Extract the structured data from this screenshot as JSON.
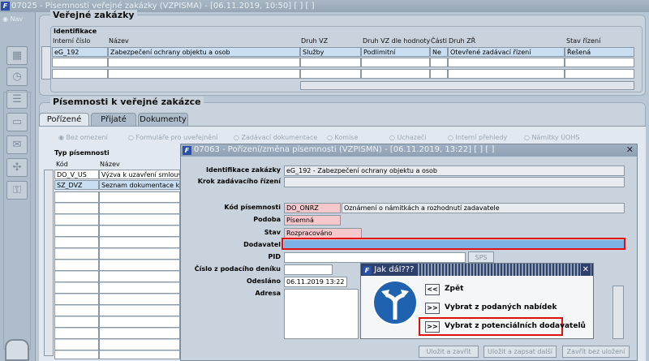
{
  "window": {
    "title": "07025 - Písemnosti veřejné zakázky (VZPISMA) - [06.11.2019, 10:50]   [ ]  [ ]",
    "logo": "F"
  },
  "nav": {
    "label": "Nav"
  },
  "zakazky": {
    "title": "Veřejné zakázky",
    "group_label": "Identifikace",
    "headers": [
      "Interní číslo",
      "Název",
      "Druh VZ",
      "Druh VZ dle hodnoty",
      "Části",
      "Druh ZŘ",
      "Stav řízení"
    ],
    "rows": [
      [
        "eG_192",
        "Zabezpečení ochrany objektu a osob",
        "Služby",
        "Podlimitní",
        "Ne",
        "Otevřené zadávací řízení",
        "Řešená"
      ],
      [
        "",
        "",
        "",
        "",
        "",
        "",
        ""
      ],
      [
        "",
        "",
        "",
        "",
        "",
        "",
        ""
      ]
    ]
  },
  "pisemnosti": {
    "title": "Písemnosti k veřejné zakázce",
    "tabs": [
      "Pořízené",
      "Přijaté",
      "Dokumenty"
    ],
    "radios": [
      "Bez omezení",
      "Formuláře pro uveřejnění",
      "Zadávací dokumentace",
      "Komise",
      "Uchazeči",
      "Interní přehledy",
      "Námitky ÚOHS"
    ],
    "typ_label": "Typ písemnosti",
    "col_kod": "Kód",
    "col_nazev": "Název",
    "rows": [
      [
        "DO_V_US",
        "Výzva k uzavření smlouvy"
      ],
      [
        "SZ_DVZ",
        "Seznam dokumentace k VZ"
      ]
    ]
  },
  "form": {
    "title": "07063 - Pořízení/změna písemnosti (VZPISMN) - [06.11.2019, 13:22]   [ ]  [ ]",
    "identifikace_label": "Identifikace zakázky",
    "identifikace_code": "eG_192",
    "identifikace_name": "Zabezpečení ochrany objektu a osob",
    "krok_label": "Krok zadávacího řízení",
    "kod_label": "Kód písemnosti",
    "kod_value": "DO_ONRZ",
    "kod_desc": "Oznámení o námitkách a rozhodnutí zadavatele",
    "podoba_label": "Podoba",
    "podoba_value": "Písemná",
    "stav_label": "Stav",
    "stav_value": "Rozpracováno",
    "dodavatel_label": "Dodavatel",
    "dodavatel_value": "",
    "pid_label": "PID",
    "sps_label": "SPS",
    "cislo_label": "Číslo z podacího deníku",
    "odeslano_label": "Odesláno",
    "odeslano_value": "06.11.2019 13:22",
    "adresa_label": "Adresa",
    "btn_save_close": "Uložit a zavřít",
    "btn_save_next": "Uložit a zapsat další",
    "btn_close_nosave": "Zavřít bez uložení"
  },
  "popup": {
    "title": "Jak dál???",
    "options": [
      {
        "button": "<<",
        "label": "Zpět"
      },
      {
        "button": ">>",
        "label": "Vybrat z podaných nabídek"
      },
      {
        "button": ">>",
        "label": "Vybrat z potenciálních dodavatelů"
      }
    ]
  },
  "colors": {
    "selection": "#c9def0",
    "required": "#f6c8cb",
    "highlight": "#e01010",
    "active_field": "#7eb2e6"
  }
}
